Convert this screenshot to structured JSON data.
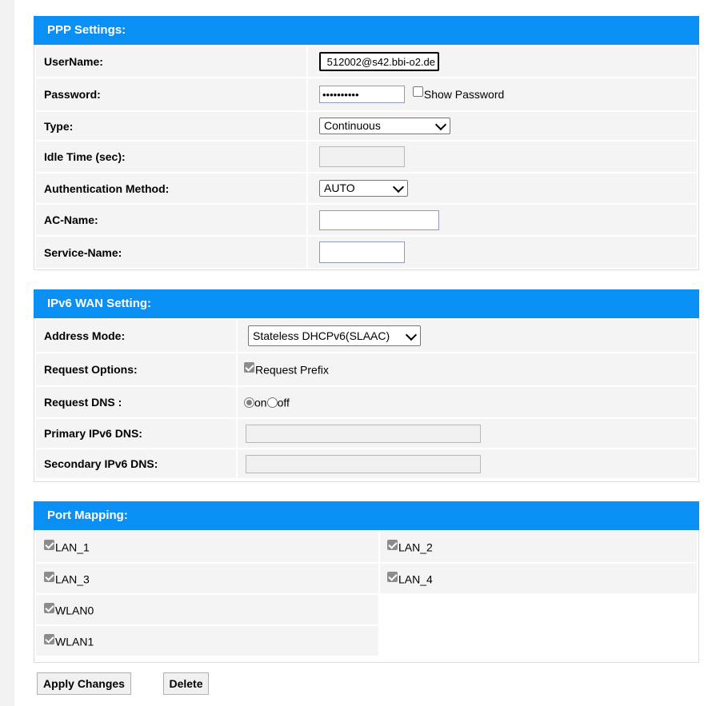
{
  "ppp": {
    "title": "PPP Settings:",
    "username_label": "UserName:",
    "username_value": "512002@s42.bbi-o2.de",
    "password_label": "Password:",
    "password_value": "••••••••••",
    "show_password_label": "Show Password",
    "type_label": "Type:",
    "type_value": "Continuous",
    "idle_label": "Idle Time (sec):",
    "idle_value": "",
    "auth_label": "Authentication Method:",
    "auth_value": "AUTO",
    "acname_label": "AC-Name:",
    "acname_value": "",
    "service_label": "Service-Name:",
    "service_value": ""
  },
  "ipv6": {
    "title": "IPv6 WAN Setting:",
    "address_mode_label": "Address Mode:",
    "address_mode_value": "Stateless DHCPv6(SLAAC)",
    "request_options_label": "Request Options:",
    "request_prefix_label": "Request Prefix",
    "request_dns_label": "Request DNS :",
    "dns_on_label": "on",
    "dns_off_label": "off",
    "primary_dns_label": "Primary IPv6 DNS:",
    "primary_dns_value": "",
    "secondary_dns_label": "Secondary IPv6 DNS:",
    "secondary_dns_value": ""
  },
  "port_mapping": {
    "title": "Port Mapping:",
    "ports": [
      "LAN_1",
      "LAN_2",
      "LAN_3",
      "LAN_4",
      "WLAN0",
      "WLAN1"
    ]
  },
  "actions": {
    "apply_label": "Apply Changes",
    "delete_label": "Delete"
  },
  "colors": {
    "header_blue": "#0a8ff5",
    "row_grey": "#f4f4f4"
  }
}
